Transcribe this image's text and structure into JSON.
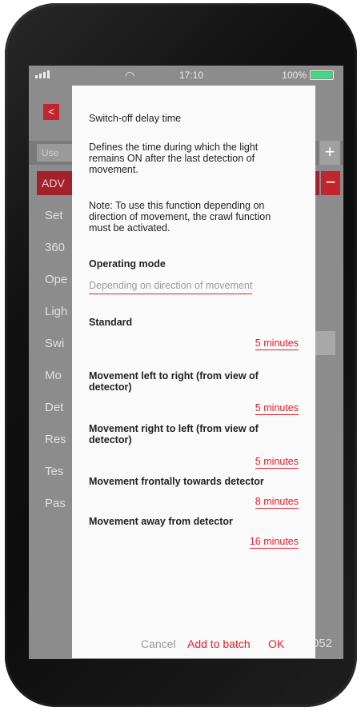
{
  "status_bar": {
    "time": "17:10",
    "battery": "100%"
  },
  "background": {
    "back_glyph": "<",
    "search_placeholder": "Use",
    "plus_glyph": "+",
    "minus_glyph": "−",
    "adv_label": "ADV",
    "list_items": [
      "Set",
      "360",
      "Ope",
      "Ligh",
      "Swi",
      "Mo",
      "Det",
      "Res",
      "Tes",
      "Pas"
    ],
    "trailing_number": "052"
  },
  "dialog": {
    "title": "Switch-off delay time",
    "description_lines": [
      "Defines the time during which the light",
      "remains ON after the last detection of",
      "movement."
    ],
    "note_lines": [
      "Note: To use this function depending on",
      "direction of movement, the crawl function",
      "must be activated."
    ],
    "operating_mode_label": "Operating mode",
    "operating_mode_value": "Depending on direction of movement",
    "settings": [
      {
        "label_lines": [
          "Standard"
        ],
        "value": "5 minutes"
      },
      {
        "label_lines": [
          "Movement left to right (from view of",
          "detector)"
        ],
        "value": "5 minutes"
      },
      {
        "label_lines": [
          "Movement right to left (from view of",
          "detector)"
        ],
        "value": "5 minutes"
      },
      {
        "label_lines": [
          "Movement frontally towards detector"
        ],
        "value": "8 minutes"
      },
      {
        "label_lines": [
          "Movement away from detector"
        ],
        "value": "16 minutes"
      }
    ],
    "actions": {
      "cancel": "Cancel",
      "add_to_batch": "Add to batch",
      "ok": "OK"
    }
  }
}
